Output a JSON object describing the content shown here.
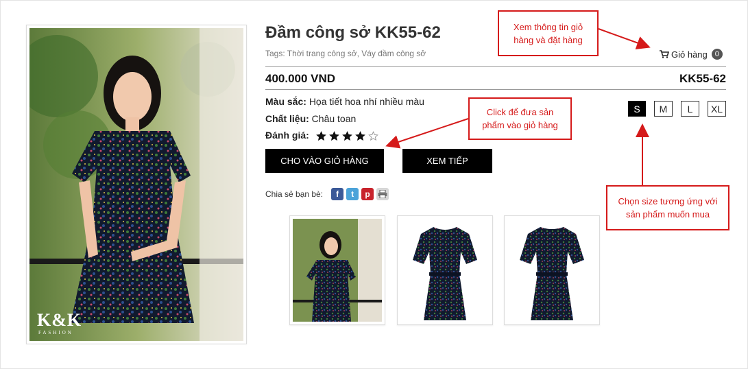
{
  "product": {
    "title": "Đầm công sở KK55-62",
    "tags": "Tags: Thời trang công sở, Váy đầm công sở",
    "price": "400.000 VND",
    "sku": "KK55-62",
    "color_label": "Màu sắc:",
    "color_value": "Họa tiết hoa nhí nhiều màu",
    "material_label": "Chất liệu:",
    "material_value": "Châu toan",
    "rating_label": "Đánh giá:",
    "rating": 4,
    "rating_max": 5,
    "brand_logo": "K&K",
    "brand_sub": "FASHION"
  },
  "cart": {
    "label": "Giỏ hàng",
    "count": "0",
    "icon": "cart-icon"
  },
  "buttons": {
    "add_to_cart": "CHO VÀO GIỎ HÀNG",
    "continue": "XEM TIẾP"
  },
  "sizes": [
    "S",
    "M",
    "L",
    "XL"
  ],
  "selected_size": "S",
  "share": {
    "label": "Chia sẻ bạn bè:",
    "icons": [
      "facebook-icon",
      "twitter-icon",
      "pinterest-icon",
      "print-icon"
    ]
  },
  "callouts": {
    "cart_info": "Xem thông tin giỏ hàng và đặt hàng",
    "add_cart": "Click để đưa sản phẩm vào giỏ hàng",
    "size": "Chọn size tương ứng với sản phẩm muốn mua"
  },
  "colors": {
    "accent": "#d51a1a",
    "button": "#000000",
    "rule": "#999999"
  }
}
